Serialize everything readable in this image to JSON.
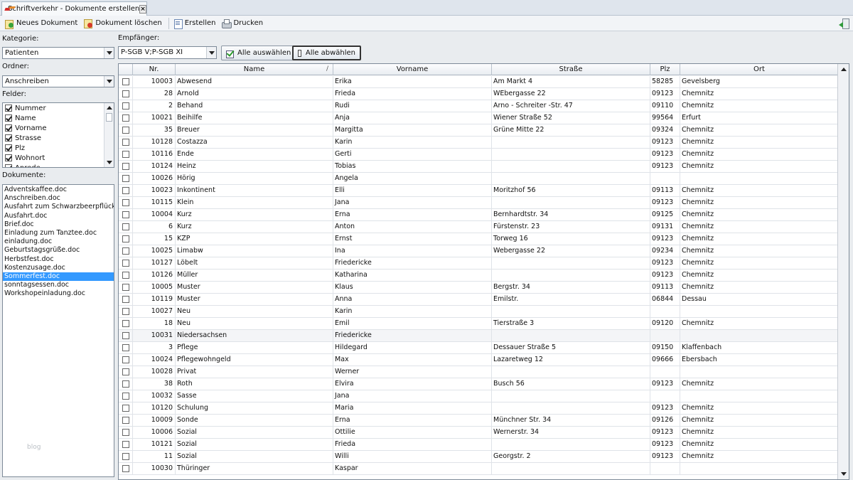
{
  "tab": {
    "title": "Schriftverkehr - Dokumente erstellen",
    "close": "×"
  },
  "toolbar": {
    "new_document": "Neues Dokument",
    "delete_document": "Dokument löschen",
    "create": "Erstellen",
    "print": "Drucken"
  },
  "left": {
    "category_label": "Kategorie:",
    "category_value": "Patienten",
    "folder_label": "Ordner:",
    "folder_value": "Anschreiben",
    "fields_label": "Felder:",
    "fields": [
      "Nummer",
      "Name",
      "Vorname",
      "Strasse",
      "Plz",
      "Wohnort",
      "Anrede"
    ],
    "documents_label": "Dokumente:",
    "documents": [
      "Adventskaffee.doc",
      "Anschreiben.doc",
      "Ausfahrt zum Schwarzbeerpflücken",
      "Ausfahrt.doc",
      "Brief.doc",
      "Einladung zum Tanztee.doc",
      "einladung.doc",
      "Geburtstagsgrüße.doc",
      "Herbstfest.doc",
      "Kostenzusage.doc",
      "Sommerfest.doc",
      "sonntagsessen.doc",
      "Workshopeinladung.doc"
    ],
    "selected_document": "Sommerfest.doc",
    "watermark": "blog"
  },
  "right": {
    "recipient_label": "Empfänger:",
    "recipient_value": "P-SGB V;P-SGB XI",
    "select_all": "Alle auswählen",
    "deselect_all": "Alle abwählen",
    "columns": [
      "Nr.",
      "Name",
      "Vorname",
      "Straße",
      "Plz",
      "Ort"
    ],
    "sort_indicator": "/",
    "rows": [
      [
        "10003",
        "Abwesend",
        "Erika",
        "Am Markt 4",
        "58285",
        "Gevelsberg"
      ],
      [
        "28",
        "Arnold",
        "Frieda",
        "WEbergasse 22",
        "09123",
        "Chemnitz"
      ],
      [
        "2",
        "Behand",
        "Rudi",
        "Arno - Schreiter -Str. 47",
        "09110",
        "Chemnitz"
      ],
      [
        "10021",
        "Beihilfe",
        "Anja",
        "Wiener Straße 52",
        "99564",
        "Erfurt"
      ],
      [
        "35",
        "Breuer",
        "Margitta",
        "Grüne Mitte 22",
        "09324",
        "Chemnitz"
      ],
      [
        "10128",
        "Costazza",
        "Karin",
        "",
        "09123",
        "Chemnitz"
      ],
      [
        "10116",
        "Ende",
        "Gerti",
        "",
        "09123",
        "Chemnitz"
      ],
      [
        "10124",
        "Heinz",
        "Tobias",
        "",
        "09123",
        "Chemnitz"
      ],
      [
        "10026",
        "Hörig",
        "Angela",
        "",
        "",
        ""
      ],
      [
        "10023",
        "Inkontinent",
        "Elli",
        "Moritzhof 56",
        "09113",
        "Chemnitz"
      ],
      [
        "10115",
        "Klein",
        "Jana",
        "",
        "09123",
        "Chemnitz"
      ],
      [
        "10004",
        "Kurz",
        "Erna",
        "Bernhardtstr. 34",
        "09125",
        "Chemnitz"
      ],
      [
        "6",
        "Kurz",
        "Anton",
        "Fürstenstr. 23",
        "09131",
        "Chemnitz"
      ],
      [
        "15",
        "KZP",
        "Ernst",
        "Torweg 16",
        "09123",
        "Chemnitz"
      ],
      [
        "10025",
        "Limabw",
        "Ina",
        "Webergasse 22",
        "09234",
        "Chemnitz"
      ],
      [
        "10127",
        "Löbelt",
        "Friedericke",
        "",
        "09123",
        "Chemnitz"
      ],
      [
        "10126",
        "Müller",
        "Katharina",
        "",
        "09123",
        "Chemnitz"
      ],
      [
        "10005",
        "Muster",
        "Klaus",
        "Bergstr. 34",
        "09113",
        "Chemnitz"
      ],
      [
        "10119",
        "Muster",
        "Anna",
        "Emilstr.",
        "06844",
        "Dessau"
      ],
      [
        "10027",
        "Neu",
        "Karin",
        "",
        "",
        ""
      ],
      [
        "18",
        "Neu",
        "Emil",
        "Tierstraße 3",
        "09120",
        "Chemnitz"
      ],
      [
        "10031",
        "Niedersachsen",
        "Friedericke",
        "",
        "",
        ""
      ],
      [
        "3",
        "Pflege",
        "Hildegard",
        "Dessauer Straße 5",
        "09150",
        "Klaffenbach"
      ],
      [
        "10024",
        "Pflegewohngeld",
        "Max",
        "Lazaretweg 12",
        "09666",
        "Ebersbach"
      ],
      [
        "10028",
        "Privat",
        "Werner",
        "",
        "",
        ""
      ],
      [
        "38",
        "Roth",
        "Elvira",
        "Busch 56",
        "09123",
        "Chemnitz"
      ],
      [
        "10032",
        "Sasse",
        "Jana",
        "",
        "",
        ""
      ],
      [
        "10120",
        "Schulung",
        "Maria",
        "",
        "09123",
        "Chemnitz"
      ],
      [
        "10009",
        "Sonde",
        "Erna",
        "Münchner Str. 34",
        "09126",
        "Chemnitz"
      ],
      [
        "10006",
        "Sozial",
        "Ottilie",
        "Wernerstr. 34",
        "09123",
        "Chemnitz"
      ],
      [
        "10121",
        "Sozial",
        "Frieda",
        "",
        "09123",
        "Chemnitz"
      ],
      [
        "11",
        "Sozial",
        "Willi",
        "Georgstr. 2",
        "09123",
        "Chemnitz"
      ],
      [
        "10030",
        "Thüringer",
        "Kaspar",
        "",
        "",
        ""
      ]
    ]
  }
}
